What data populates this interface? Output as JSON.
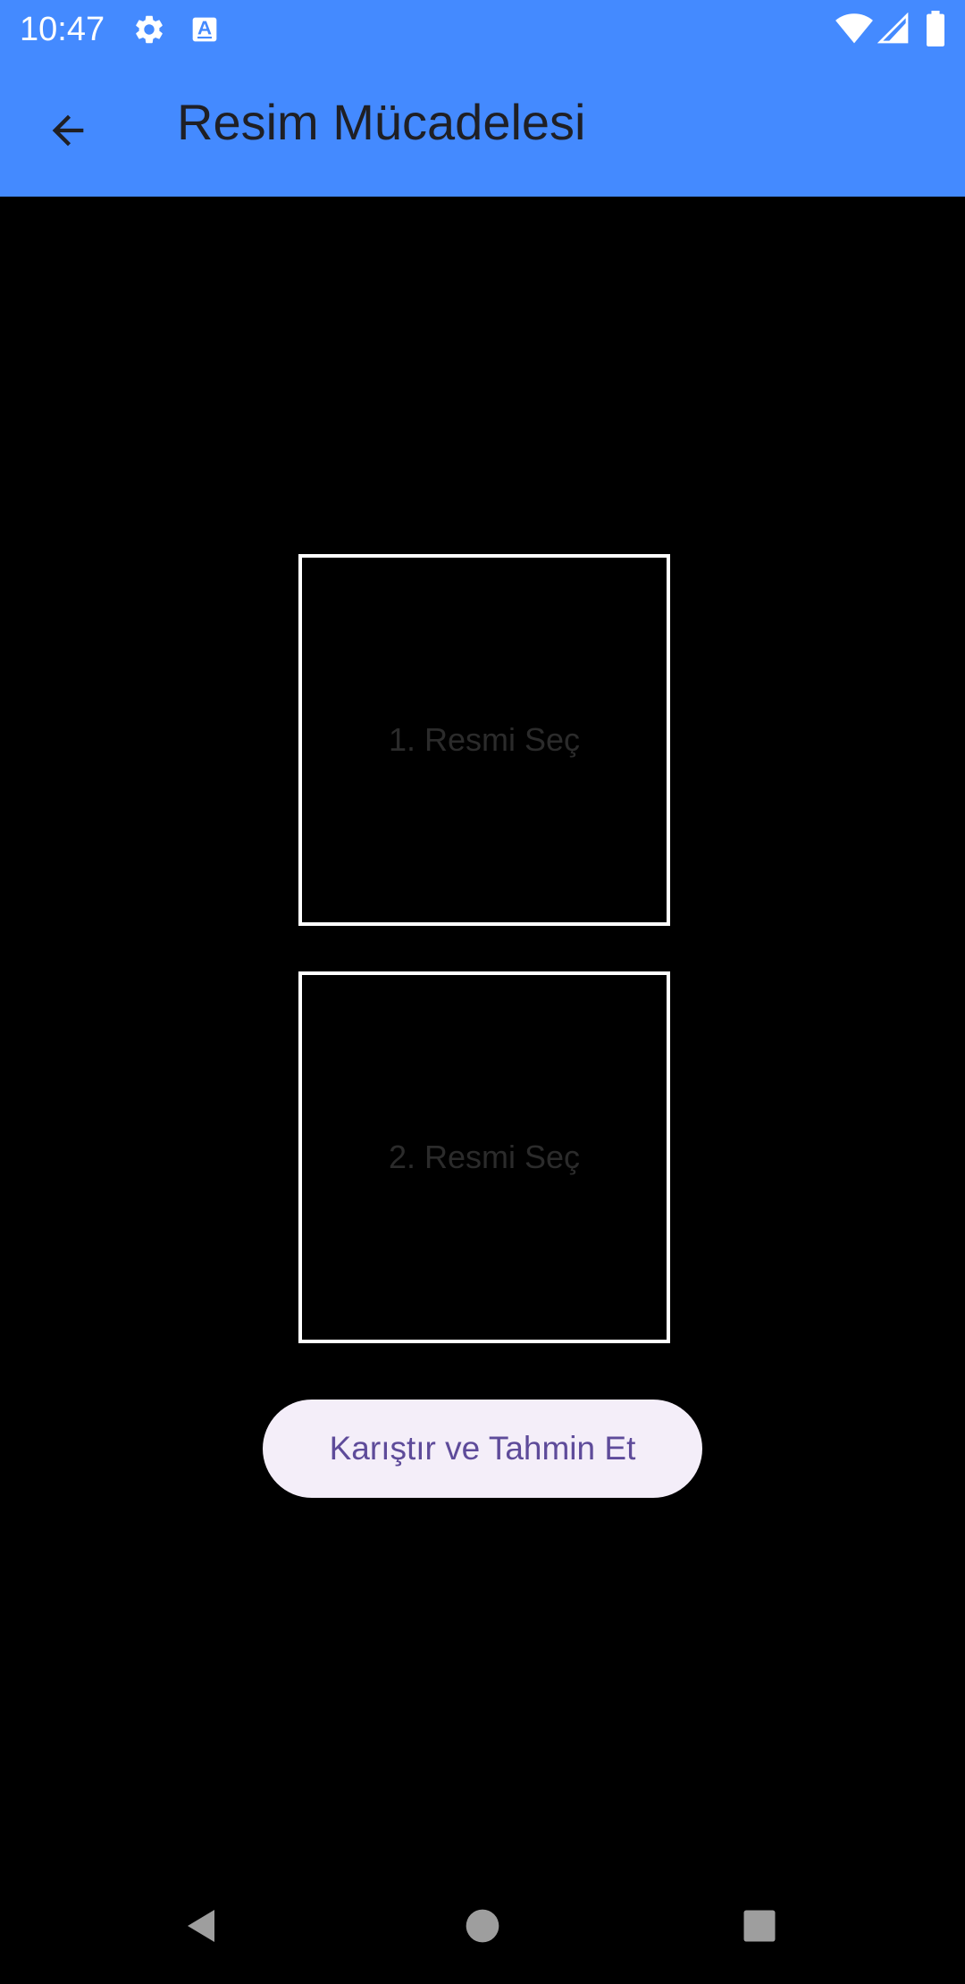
{
  "status_bar": {
    "time": "10:47",
    "icons": [
      "gear-icon",
      "font-a-icon",
      "wifi-icon",
      "signal-icon",
      "battery-icon"
    ],
    "background": "#448AFF"
  },
  "app_bar": {
    "title": "Resim Mücadelesi",
    "back_icon": "arrow-back-icon",
    "background": "#448AFF"
  },
  "main": {
    "slot1_label": "1. Resmi Seç",
    "slot2_label": "2. Resmi Seç",
    "action_button_label": "Karıştır ve Tahmin Et",
    "action_button_color": "#F4EEF9",
    "action_text_color": "#5E4B9A"
  },
  "nav_bar": {
    "buttons": [
      "nav-back-icon",
      "nav-home-icon",
      "nav-recents-icon"
    ]
  }
}
